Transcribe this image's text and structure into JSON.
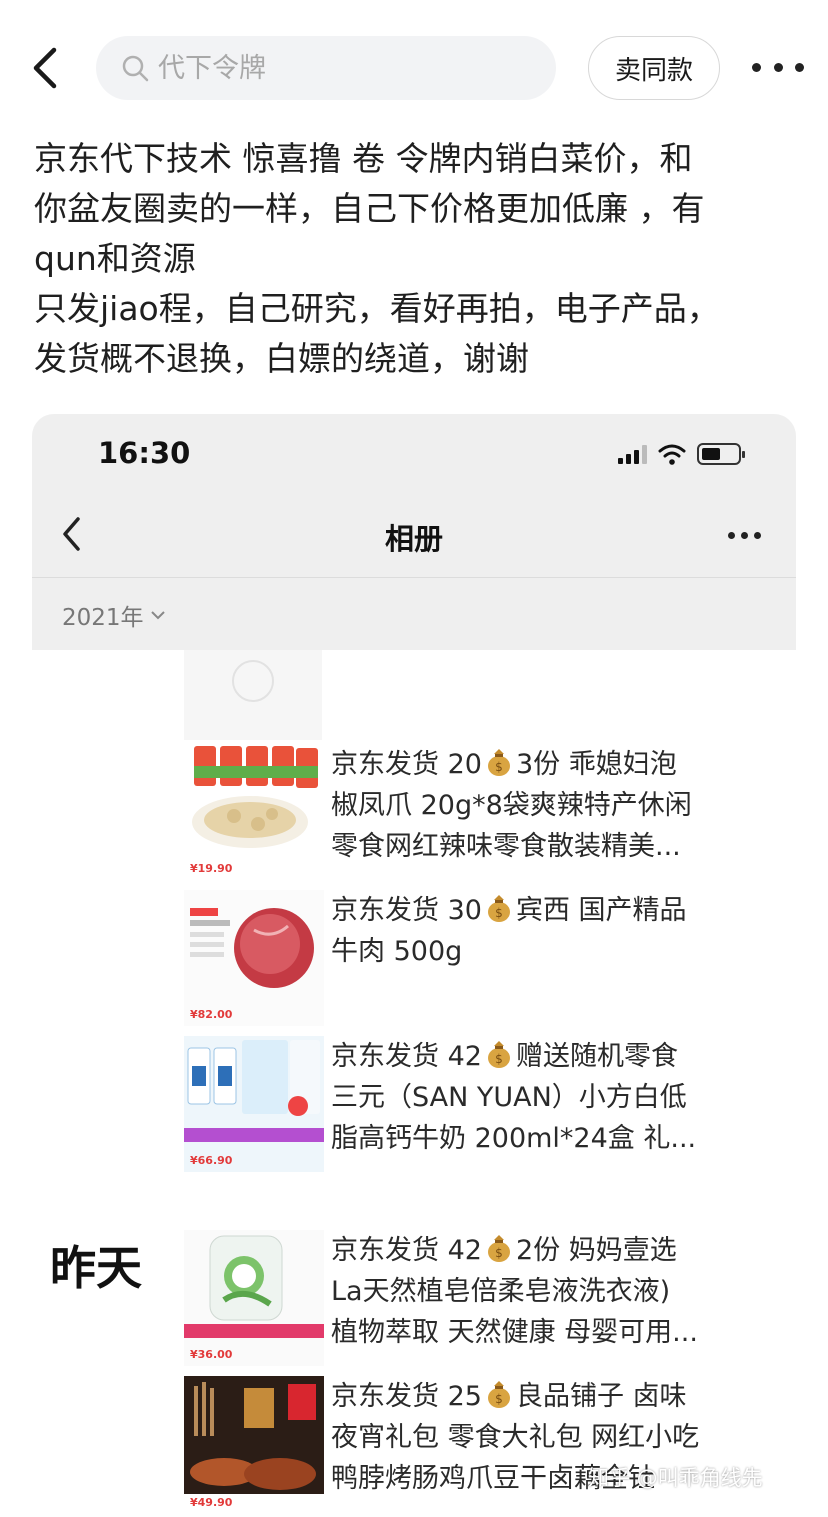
{
  "search": {
    "placeholder": "代下令牌"
  },
  "topbar": {
    "sell_same_label": "卖同款"
  },
  "description": {
    "lines": [
      "京东代下技术  惊喜撸 卷 令牌内销白菜价，和",
      "你盆友圈卖的一样，自己下价格更加低廉 ，有",
      "qun和资源",
      "只发jiao程，自己研究，看好再拍，电子产品，",
      "发货概不退换，白嫖的绕道，谢谢"
    ]
  },
  "screenshot": {
    "status_time": "16:30",
    "nav_title": "相册",
    "year_filter": "2021年",
    "section_yesterday": "昨天",
    "items": [
      {
        "lines": [
          "京东发货 20",
          "3份 乖媳妇泡",
          "椒凤爪 20g*8袋爽辣特产休闲",
          "零食网红辣味零食散装精美..."
        ],
        "price": "¥19.90"
      },
      {
        "lines": [
          "京东发货 30",
          "宾西 国产精品",
          "牛肉 500g"
        ],
        "price": "¥82.00"
      },
      {
        "lines": [
          "京东发货 42",
          "赠送随机零食",
          "三元（SAN YUAN）小方白低",
          "脂高钙牛奶 200ml*24盒 礼..."
        ],
        "price": "¥66.90"
      },
      {
        "lines": [
          "京东发货 42",
          "2份  妈妈壹选",
          "La天然植皂倍柔皂液洗衣液)",
          "植物萃取 天然健康 母婴可用..."
        ],
        "price": "¥36.00"
      },
      {
        "lines": [
          "京东发货 25",
          "良品铺子 卤味",
          "夜宵礼包 零食大礼包 网红小吃",
          "鸭脖烤肠鸡爪豆干卤藕全钍"
        ],
        "price": "¥49.90"
      }
    ],
    "watermark": "知乎 @叫乖角线先"
  },
  "icons": {
    "back": "back-chevron-icon",
    "search": "search-icon",
    "more": "more-dots-icon",
    "money_bag": "money-bag-icon"
  },
  "colors": {
    "price_red": "#e23a3a",
    "header_gray": "#efefef"
  }
}
